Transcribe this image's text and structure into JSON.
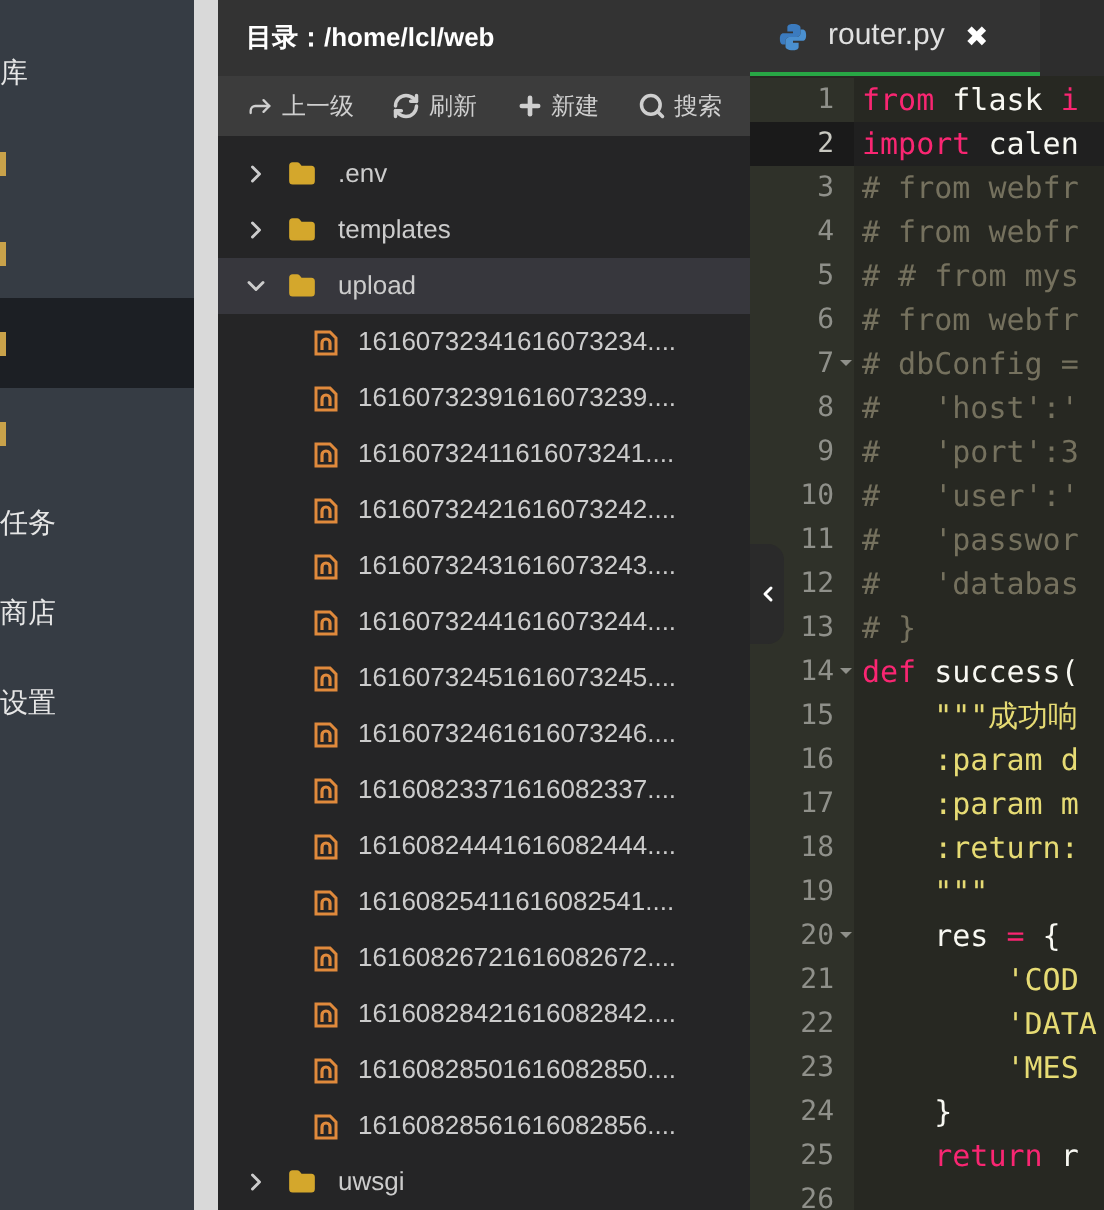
{
  "sidebar": {
    "items": [
      {
        "label": "库",
        "selected": false
      },
      {
        "selected": false
      },
      {
        "selected": false
      },
      {
        "selected": true
      },
      {
        "selected": false
      },
      {
        "label": "任务",
        "selected": false
      },
      {
        "label": "商店",
        "selected": false
      },
      {
        "label": "设置",
        "selected": false
      }
    ]
  },
  "file_panel": {
    "title": "目录：/home/lcl/web",
    "toolbar": [
      {
        "label": "上一级",
        "kind": "up"
      },
      {
        "label": "刷新",
        "kind": "refresh"
      },
      {
        "label": "新建",
        "kind": "new"
      },
      {
        "label": "搜索",
        "kind": "search"
      }
    ],
    "tree": [
      {
        "name": ".env",
        "kind": "folder",
        "expanded": false,
        "selected": false
      },
      {
        "name": "templates",
        "kind": "folder",
        "expanded": false,
        "selected": false
      },
      {
        "name": "upload",
        "kind": "folder",
        "expanded": true,
        "selected": true,
        "children": [
          {
            "name": "16160732341616073234....",
            "kind": "file",
            "selected": false
          },
          {
            "name": "16160732391616073239....",
            "kind": "file",
            "selected": false
          },
          {
            "name": "16160732411616073241....",
            "kind": "file",
            "selected": false
          },
          {
            "name": "16160732421616073242....",
            "kind": "file",
            "selected": false
          },
          {
            "name": "16160732431616073243....",
            "kind": "file",
            "selected": false
          },
          {
            "name": "16160732441616073244....",
            "kind": "file",
            "selected": false
          },
          {
            "name": "16160732451616073245....",
            "kind": "file",
            "selected": false
          },
          {
            "name": "16160732461616073246....",
            "kind": "file",
            "selected": false
          },
          {
            "name": "16160823371616082337....",
            "kind": "file",
            "selected": false
          },
          {
            "name": "16160824441616082444....",
            "kind": "file",
            "selected": false
          },
          {
            "name": "16160825411616082541....",
            "kind": "file",
            "selected": false
          },
          {
            "name": "16160826721616082672....",
            "kind": "file",
            "selected": false
          },
          {
            "name": "16160828421616082842....",
            "kind": "file",
            "selected": false
          },
          {
            "name": "16160828501616082850....",
            "kind": "file",
            "selected": false
          },
          {
            "name": "16160828561616082856....",
            "kind": "file",
            "selected": false
          }
        ]
      },
      {
        "name": "uwsgi",
        "kind": "folder",
        "expanded": false,
        "selected": false
      }
    ]
  },
  "editor": {
    "tabs": [
      {
        "label": "router.py",
        "selected": true,
        "close": "✖"
      }
    ],
    "lines": [
      {
        "number": "1",
        "active": false,
        "fold": false,
        "tokens": [
          {
            "text": "from",
            "kind": "keyword"
          },
          {
            "text": " flask ",
            "kind": "plain"
          },
          {
            "text": "i",
            "kind": "keyword"
          }
        ]
      },
      {
        "number": "2",
        "active": true,
        "fold": false,
        "tokens": [
          {
            "text": "import",
            "kind": "keyword"
          },
          {
            "text": " calen",
            "kind": "plain"
          }
        ]
      },
      {
        "number": "3",
        "active": false,
        "fold": false,
        "tokens": [
          {
            "text": "# from webfr",
            "kind": "comment"
          }
        ]
      },
      {
        "number": "4",
        "active": false,
        "fold": false,
        "tokens": [
          {
            "text": "# from webfr",
            "kind": "comment"
          }
        ]
      },
      {
        "number": "5",
        "active": false,
        "fold": false,
        "tokens": [
          {
            "text": "# # from mys",
            "kind": "comment"
          }
        ]
      },
      {
        "number": "6",
        "active": false,
        "fold": false,
        "tokens": [
          {
            "text": "# from webfr",
            "kind": "comment"
          }
        ]
      },
      {
        "number": "7",
        "active": false,
        "fold": true,
        "tokens": [
          {
            "text": "# dbConfig =",
            "kind": "comment"
          }
        ]
      },
      {
        "number": "8",
        "active": false,
        "fold": false,
        "tokens": [
          {
            "text": "#   'host':'",
            "kind": "comment"
          }
        ]
      },
      {
        "number": "9",
        "active": false,
        "fold": false,
        "tokens": [
          {
            "text": "#   'port':3",
            "kind": "comment"
          }
        ]
      },
      {
        "number": "10",
        "active": false,
        "fold": false,
        "tokens": [
          {
            "text": "#   'user':'",
            "kind": "comment"
          }
        ]
      },
      {
        "number": "11",
        "active": false,
        "fold": false,
        "tokens": [
          {
            "text": "#   'passwor",
            "kind": "comment"
          }
        ]
      },
      {
        "number": "12",
        "active": false,
        "fold": false,
        "tokens": [
          {
            "text": "#   'databas",
            "kind": "comment"
          }
        ]
      },
      {
        "number": "13",
        "active": false,
        "fold": false,
        "tokens": [
          {
            "text": "# }",
            "kind": "comment"
          }
        ]
      },
      {
        "number": "14",
        "active": false,
        "fold": true,
        "tokens": [
          {
            "text": "def",
            "kind": "keyword"
          },
          {
            "text": " success(",
            "kind": "plain"
          }
        ]
      },
      {
        "number": "15",
        "active": false,
        "fold": false,
        "tokens": [
          {
            "text": "    \"\"\"成功响",
            "kind": "string"
          }
        ]
      },
      {
        "number": "16",
        "active": false,
        "fold": false,
        "tokens": [
          {
            "text": "    :param d",
            "kind": "string"
          }
        ]
      },
      {
        "number": "17",
        "active": false,
        "fold": false,
        "tokens": [
          {
            "text": "    :param m",
            "kind": "string"
          }
        ]
      },
      {
        "number": "18",
        "active": false,
        "fold": false,
        "tokens": [
          {
            "text": "    :return:",
            "kind": "string"
          }
        ]
      },
      {
        "number": "19",
        "active": false,
        "fold": false,
        "tokens": [
          {
            "text": "    \"\"\"",
            "kind": "string"
          }
        ]
      },
      {
        "number": "20",
        "active": false,
        "fold": true,
        "tokens": [
          {
            "text": "    res ",
            "kind": "plain"
          },
          {
            "text": "=",
            "kind": "keyword"
          },
          {
            "text": " {",
            "kind": "plain"
          }
        ]
      },
      {
        "number": "21",
        "active": false,
        "fold": false,
        "tokens": [
          {
            "text": "        'COD",
            "kind": "string"
          }
        ]
      },
      {
        "number": "22",
        "active": false,
        "fold": false,
        "tokens": [
          {
            "text": "        'DATA",
            "kind": "string"
          }
        ]
      },
      {
        "number": "23",
        "active": false,
        "fold": false,
        "tokens": [
          {
            "text": "        'MES",
            "kind": "string"
          }
        ]
      },
      {
        "number": "24",
        "active": false,
        "fold": false,
        "tokens": [
          {
            "text": "    }",
            "kind": "plain"
          }
        ]
      },
      {
        "number": "25",
        "active": false,
        "fold": false,
        "tokens": [
          {
            "text": "    return",
            "kind": "keyword"
          },
          {
            "text": " r",
            "kind": "plain"
          }
        ]
      },
      {
        "number": "26",
        "active": false,
        "fold": false
      }
    ]
  }
}
